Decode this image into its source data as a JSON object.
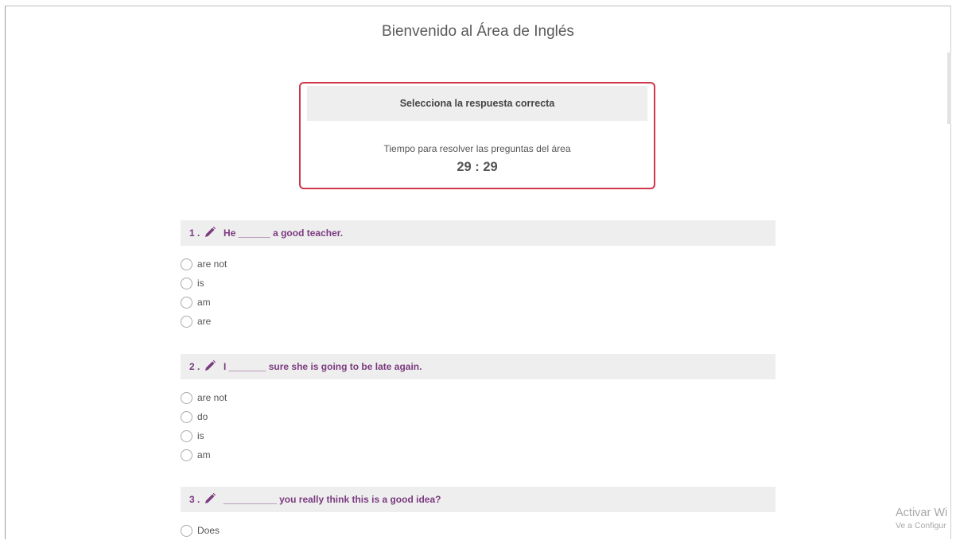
{
  "page": {
    "title": "Bienvenido al Área de Inglés"
  },
  "info_box": {
    "heading": "Selecciona la respuesta correcta",
    "timer_label": "Tiempo para resolver las preguntas del área",
    "timer_value": "29 : 29"
  },
  "colors": {
    "accent_border": "#d0364a",
    "question_text": "#7b3a7f",
    "band_background": "#eeeeee"
  },
  "questions": [
    {
      "number": "1 .",
      "icon": "pencil-icon",
      "text": "He ______ a good teacher.",
      "options": [
        "are not",
        "is",
        "am",
        "are"
      ]
    },
    {
      "number": "2 .",
      "icon": "pencil-icon",
      "text": "I _______ sure she is going to be late again.",
      "options": [
        "are not",
        "do",
        "is",
        "am"
      ]
    },
    {
      "number": "3 .",
      "icon": "pencil-icon",
      "text": "__________ you really think this is a good idea?",
      "options": [
        "Does"
      ]
    }
  ],
  "watermark": {
    "line1": "Activar Wi",
    "line2": "Ve a Configur"
  }
}
